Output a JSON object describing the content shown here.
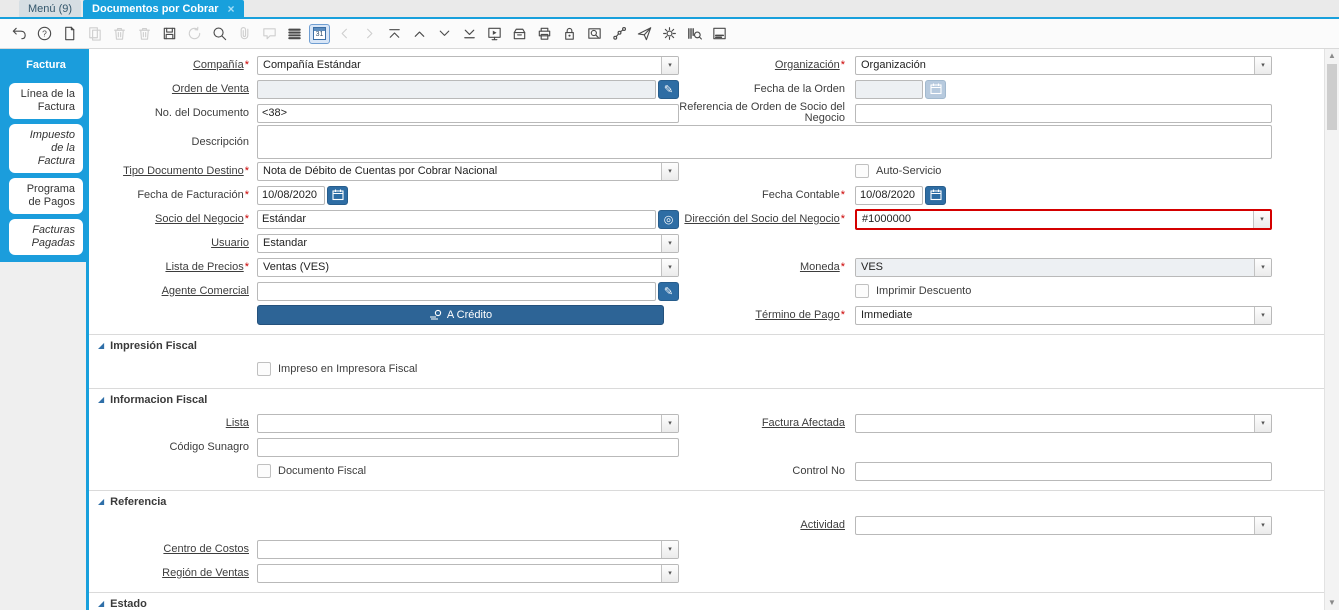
{
  "glyphs": {
    "dropdown": "▾",
    "scroll_up": "▲",
    "scroll_down": "▼",
    "close": "×",
    "required_marker": "*",
    "calendar_day": "31",
    "collapse_triangle": "◢"
  },
  "colors": {
    "accent_blue": "#18a0dc",
    "sidebar_blue": "#1b9ddc",
    "button_blue": "#2e6da4",
    "action_button_blue": "#2d6496",
    "highlight_red": "#d40000",
    "mandatory_star": "#cc0000",
    "disabled_field": "#edf0f3"
  },
  "window_tabs": [
    {
      "label": "Menú (9)",
      "active": false,
      "closable": false
    },
    {
      "label": "Documentos por Cobrar",
      "active": true,
      "closable": true,
      "close_icon": "×"
    }
  ],
  "toolbar": {
    "icons": [
      {
        "name": "undo",
        "enabled": true
      },
      {
        "name": "help",
        "enabled": true
      },
      {
        "name": "new-record",
        "enabled": true
      },
      {
        "name": "copy-record",
        "enabled": false
      },
      {
        "name": "delete-record",
        "enabled": false
      },
      {
        "name": "delete-selection",
        "enabled": false
      },
      {
        "name": "save",
        "enabled": true
      },
      {
        "name": "refresh",
        "enabled": false
      },
      {
        "name": "find",
        "enabled": true
      },
      {
        "name": "attachment",
        "enabled": false
      },
      {
        "name": "chat",
        "enabled": false
      },
      {
        "name": "grid-toggle",
        "enabled": true
      },
      {
        "name": "calendar",
        "enabled": true,
        "active": true
      },
      {
        "name": "parent-record",
        "enabled": false
      },
      {
        "name": "detail-record",
        "enabled": false
      },
      {
        "name": "first-record",
        "enabled": true
      },
      {
        "name": "previous-record",
        "enabled": true
      },
      {
        "name": "next-record",
        "enabled": true
      },
      {
        "name": "last-record",
        "enabled": true
      },
      {
        "name": "report",
        "enabled": true
      },
      {
        "name": "archive",
        "enabled": true
      },
      {
        "name": "print",
        "enabled": true
      },
      {
        "name": "lock",
        "enabled": true
      },
      {
        "name": "zoom-across",
        "enabled": true
      },
      {
        "name": "workflow",
        "enabled": true
      },
      {
        "name": "send-mail",
        "enabled": true
      },
      {
        "name": "preferences",
        "enabled": true
      },
      {
        "name": "product-info",
        "enabled": true
      },
      {
        "name": "window-help",
        "enabled": true
      }
    ]
  },
  "sidebar": {
    "tabs": [
      {
        "label": "Factura",
        "active": true,
        "italic": false
      },
      {
        "label": "Línea de la Factura",
        "active": false,
        "italic": false
      },
      {
        "label": "Impuesto de la Factura",
        "active": false,
        "italic": true
      },
      {
        "label": "Programa de Pagos",
        "active": false,
        "italic": false
      },
      {
        "label": "Facturas Pagadas",
        "active": false,
        "italic": true
      }
    ]
  },
  "form": {
    "items": [
      {
        "type": "row",
        "left": {
          "label": "Compañía",
          "required": true,
          "underline": true,
          "control": {
            "kind": "select",
            "value": "Compañía Estándar"
          }
        },
        "right": {
          "label": "Organización",
          "required": true,
          "underline": true,
          "control": {
            "kind": "select",
            "value": "Organización"
          }
        }
      },
      {
        "type": "row",
        "left": {
          "label": "Orden de Venta",
          "underline": true,
          "control": {
            "kind": "lookup",
            "value": "",
            "disabled": true,
            "button_icon": "record-edit-icon",
            "button_glyph": "✎"
          }
        },
        "right": {
          "label": "Fecha de la Orden",
          "control": {
            "kind": "date",
            "value": "",
            "disabled": true
          }
        }
      },
      {
        "type": "row",
        "left": {
          "label": "No. del Documento",
          "control": {
            "kind": "text",
            "value": "<38>"
          }
        },
        "right": {
          "label": "Referencia de Orden de Socio del Negocio",
          "control": {
            "kind": "text",
            "value": ""
          }
        }
      },
      {
        "type": "row",
        "left": {
          "label": "Descripción",
          "control": {
            "kind": "textarea",
            "value": "",
            "span": true
          }
        },
        "right": null
      },
      {
        "type": "row",
        "left": {
          "label": "Tipo Documento Destino",
          "required": true,
          "underline": true,
          "control": {
            "kind": "select",
            "value": "Nota de Débito de Cuentas por Cobrar Nacional"
          }
        },
        "right": {
          "control": {
            "kind": "checkbox",
            "label": "Auto-Servicio",
            "checked": false
          }
        }
      },
      {
        "type": "row",
        "left": {
          "label": "Fecha de Facturación",
          "required": true,
          "control": {
            "kind": "date",
            "value": "10/08/2020"
          }
        },
        "right": {
          "label": "Fecha Contable",
          "required": true,
          "control": {
            "kind": "date",
            "value": "10/08/2020"
          }
        }
      },
      {
        "type": "row",
        "left": {
          "label": "Socio del Negocio",
          "required": true,
          "underline": true,
          "control": {
            "kind": "lookup",
            "value": "Estándar",
            "button_icon": "business-partner-info-icon",
            "button_glyph": "◎"
          }
        },
        "right": {
          "label": "Dirección del Socio del Negocio",
          "required": true,
          "underline": true,
          "control": {
            "kind": "select",
            "value": "#1000000",
            "highlight": true
          }
        }
      },
      {
        "type": "row",
        "left": {
          "label": "Usuario",
          "underline": true,
          "control": {
            "kind": "select",
            "value": "Estandar"
          }
        },
        "right": null
      },
      {
        "type": "row",
        "left": {
          "label": "Lista de Precios",
          "required": true,
          "underline": true,
          "control": {
            "kind": "select",
            "value": "Ventas (VES)"
          }
        },
        "right": {
          "label": "Moneda",
          "required": true,
          "underline": true,
          "control": {
            "kind": "select",
            "value": "VES",
            "disabled": true
          }
        }
      },
      {
        "type": "row",
        "left": {
          "label": "Agente Comercial",
          "underline": true,
          "control": {
            "kind": "lookup",
            "value": "",
            "button_icon": "record-edit-icon",
            "button_glyph": "✎"
          }
        },
        "right": {
          "control": {
            "kind": "checkbox",
            "label": "Imprimir Descuento",
            "checked": false
          }
        }
      },
      {
        "type": "row",
        "left": {
          "control": {
            "kind": "action-button",
            "label": "A Crédito",
            "icon": "credit-icon"
          }
        },
        "right": {
          "label": "Término de Pago",
          "required": true,
          "underline": true,
          "control": {
            "kind": "select",
            "value": "Immediate"
          }
        }
      },
      {
        "type": "section",
        "label": "Impresión Fiscal"
      },
      {
        "type": "row",
        "left": {
          "control": {
            "kind": "checkbox",
            "label": "Impreso en Impresora Fiscal",
            "checked": false
          }
        },
        "right": null
      },
      {
        "type": "section",
        "label": "Informacion Fiscal"
      },
      {
        "type": "row",
        "left": {
          "label": "Lista",
          "underline": true,
          "control": {
            "kind": "select",
            "value": ""
          }
        },
        "right": {
          "label": "Factura Afectada",
          "underline": true,
          "control": {
            "kind": "select",
            "value": ""
          }
        }
      },
      {
        "type": "row",
        "left": {
          "label": "Código Sunagro",
          "control": {
            "kind": "text",
            "value": ""
          }
        },
        "right": null
      },
      {
        "type": "row",
        "left": {
          "control": {
            "kind": "checkbox",
            "label": "Documento Fiscal",
            "checked": false
          }
        },
        "right": {
          "label": "Control No",
          "control": {
            "kind": "text",
            "value": ""
          }
        }
      },
      {
        "type": "section",
        "label": "Referencia"
      },
      {
        "type": "row",
        "left": null,
        "right": {
          "label": "Actividad",
          "underline": true,
          "control": {
            "kind": "select",
            "value": ""
          }
        }
      },
      {
        "type": "row",
        "left": {
          "label": "Centro de Costos",
          "underline": true,
          "control": {
            "kind": "select",
            "value": ""
          }
        },
        "right": null
      },
      {
        "type": "row",
        "left": {
          "label": "Región de Ventas",
          "underline": true,
          "control": {
            "kind": "select",
            "value": ""
          }
        },
        "right": null
      },
      {
        "type": "section",
        "label": "Estado"
      }
    ]
  }
}
